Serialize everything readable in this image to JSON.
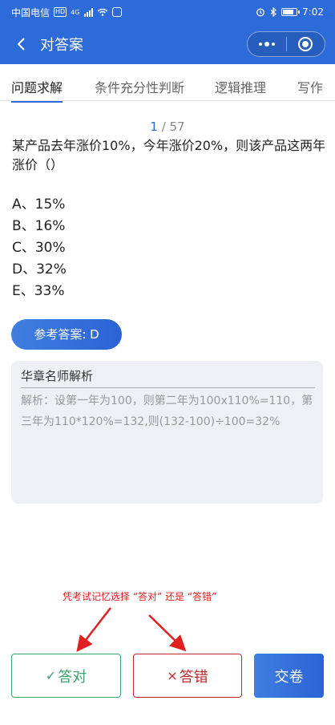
{
  "status_bar": {
    "carrier": "中国电信",
    "hd": "HD",
    "network": "4G",
    "time": "7:02"
  },
  "header": {
    "title": "对答案",
    "back_icon": "chevron-left-icon",
    "more_icon": "more-dots-icon",
    "close_icon": "target-icon"
  },
  "tabs": [
    "问题求解",
    "条件充分性判断",
    "逻辑推理",
    "写作"
  ],
  "counter": {
    "current": "1",
    "separator": " / ",
    "total": "57"
  },
  "question": {
    "text": "某产品去年涨价10%，今年涨价20%，则该产品这两年涨价（）"
  },
  "options": [
    "A、15%",
    "B、16%",
    "C、30%",
    "D、32%",
    "E、33%"
  ],
  "answer": {
    "label": "参考答案: D"
  },
  "analysis": {
    "title": "华章名师解析",
    "text": "解析：设第一年为100，则第二年为100x110%=110，第三年为110*120%=132,则(132-100)÷100=32%"
  },
  "annotation": {
    "text": "凭考试记忆选择 “答对” 还是 “答错”",
    "color": "#e02020"
  },
  "buttons": {
    "right": {
      "icon": "check-icon",
      "symbol": "✓",
      "label": "答对",
      "color": "#3aa56a"
    },
    "wrong": {
      "icon": "cross-icon",
      "symbol": "×",
      "label": "答错",
      "color": "#c0272d"
    },
    "submit": {
      "label": "交卷"
    }
  },
  "colors": {
    "primary": "#2d6bd8",
    "analysis_bg": "#eef0f5"
  }
}
